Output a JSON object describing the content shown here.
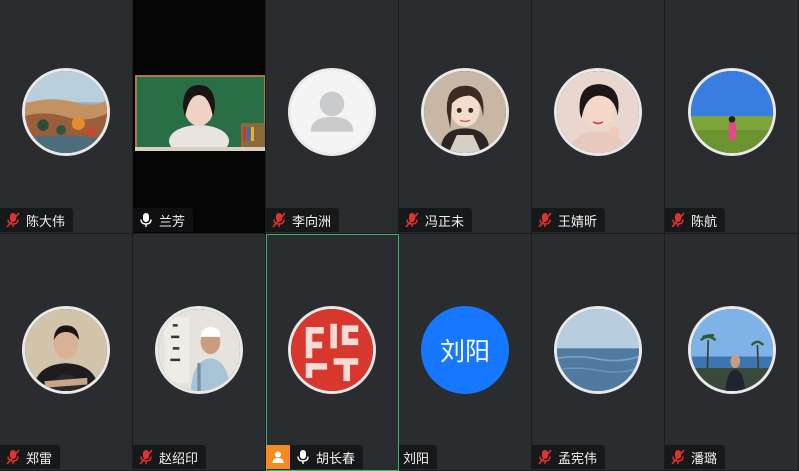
{
  "participants": [
    {
      "name": "陈大伟",
      "mic": "muted",
      "avatar": "photo-coast-landscape"
    },
    {
      "name": "兰芳",
      "mic": "on",
      "avatar": "video-classroom"
    },
    {
      "name": "李向洲",
      "mic": "muted",
      "avatar": "default-user-icon"
    },
    {
      "name": "冯正未",
      "mic": "muted",
      "avatar": "photo-anime-girl"
    },
    {
      "name": "王婧昕",
      "mic": "muted",
      "avatar": "photo-woman-portrait"
    },
    {
      "name": "陈航",
      "mic": "muted",
      "avatar": "photo-field-sky"
    },
    {
      "name": "郑雷",
      "mic": "muted",
      "avatar": "photo-man-arms-crossed"
    },
    {
      "name": "赵绍印",
      "mic": "muted",
      "avatar": "photo-man-calligraphy"
    },
    {
      "name": "胡长春",
      "mic": "on",
      "avatar": "photo-red-seal",
      "active": true
    },
    {
      "name": "刘阳",
      "mic": "none",
      "avatar": "text",
      "avatar_text": "刘阳",
      "avatar_color": "#1677ff"
    },
    {
      "name": "孟宪伟",
      "mic": "muted",
      "avatar": "photo-sea-horizon"
    },
    {
      "name": "潘璐",
      "mic": "muted",
      "avatar": "photo-palm-trees"
    }
  ],
  "colors": {
    "muted_mic": "#e0322f",
    "mic_on": "#ffffff",
    "active_border": "#3bb26b",
    "host_badge": "#f58a22",
    "text_avatar": "#1677ff"
  }
}
